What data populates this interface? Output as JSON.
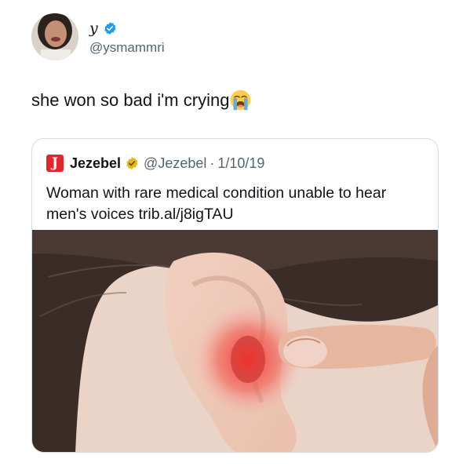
{
  "author": {
    "display_name": "y",
    "handle": "@ysmammri",
    "avatar_icon": "profile-photo",
    "verified_icon": "blue-verified-badge-icon"
  },
  "tweet": {
    "text": "she won so bad i'm crying",
    "emoji": "loudly-crying-face-emoji"
  },
  "quote": {
    "logo_letter": "J",
    "name": "Jezebel",
    "badge_icon": "gold-verified-badge-icon",
    "handle": "@Jezebel",
    "separator": "·",
    "date": "1/10/19",
    "text": "Woman with rare medical condition unable to hear men's voices trib.al/j8igTAU",
    "image": "photo-ear-with-red-pain-highlight"
  },
  "colors": {
    "text": "#0f1419",
    "secondary": "#536471",
    "border": "#d5dbe0",
    "verified_blue": "#1d9bf0",
    "verified_gold": "#e2b719",
    "jezebel_red": "#e3262b"
  }
}
